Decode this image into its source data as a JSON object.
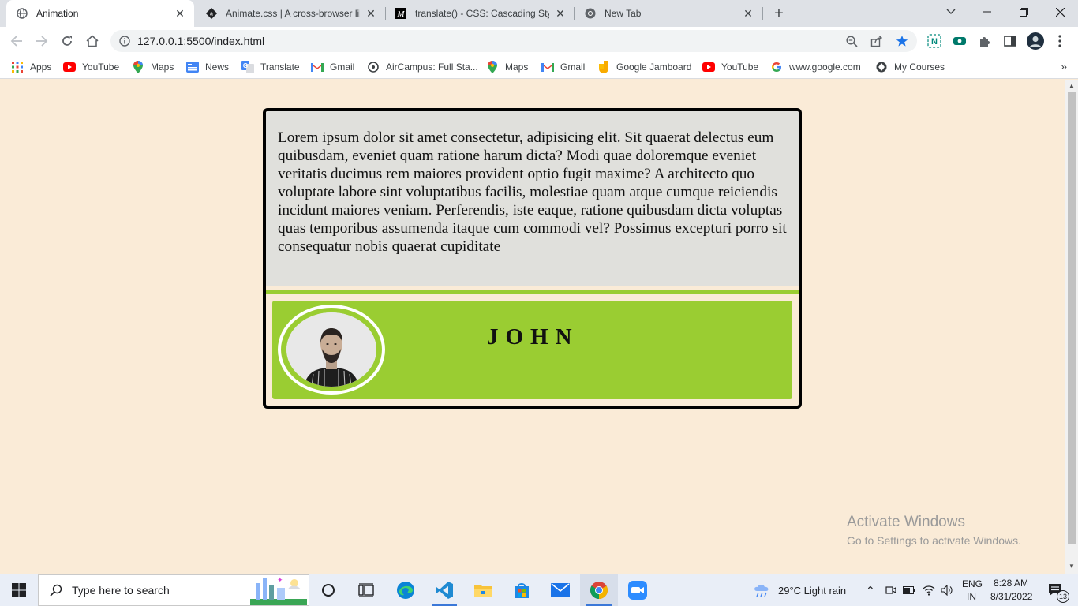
{
  "browser": {
    "tabs": [
      {
        "title": "Animation",
        "active": true,
        "icon": "globe-icon"
      },
      {
        "title": "Animate.css | A cross-browser lib",
        "active": false,
        "icon": "animate-icon"
      },
      {
        "title": "translate() - CSS: Cascading Style",
        "active": false,
        "icon": "mdn-icon"
      },
      {
        "title": "New Tab",
        "active": false,
        "icon": "chrome-icon"
      }
    ],
    "url": "127.0.0.1:5500/index.html",
    "bookmarks": [
      {
        "label": "Apps",
        "icon": "apps-grid-icon"
      },
      {
        "label": "YouTube",
        "icon": "youtube-icon"
      },
      {
        "label": "Maps",
        "icon": "maps-pin-icon"
      },
      {
        "label": "News",
        "icon": "news-icon"
      },
      {
        "label": "Translate",
        "icon": "translate-icon"
      },
      {
        "label": "Gmail",
        "icon": "gmail-icon"
      },
      {
        "label": "AirCampus: Full Sta...",
        "icon": "aircampus-icon"
      },
      {
        "label": "Maps",
        "icon": "maps-pin-icon"
      },
      {
        "label": "Gmail",
        "icon": "gmail-icon"
      },
      {
        "label": "Google Jamboard",
        "icon": "jamboard-icon"
      },
      {
        "label": "YouTube",
        "icon": "youtube-icon"
      },
      {
        "label": "www.google.com",
        "icon": "google-icon"
      },
      {
        "label": "My Courses",
        "icon": "courses-icon"
      }
    ]
  },
  "page": {
    "card_text": "Lorem ipsum dolor sit amet consectetur, adipisicing elit. Sit quaerat delectus eum quibusdam, eveniet quam ratione harum dicta? Modi quae doloremque eveniet veritatis ducimus rem maiores provident optio fugit maxime? A architecto quo voluptate labore sint voluptatibus facilis, molestiae quam atque cumque reiciendis incidunt maiores veniam. Perferendis, iste eaque, ratione quibusdam dicta voluptas quas temporibus assumenda itaque cum commodi vel? Possimus excepturi porro sit consequatur nobis quaerat cupiditate",
    "name": "JOHN"
  },
  "watermark": {
    "line1": "Activate Windows",
    "line2": "Go to Settings to activate Windows."
  },
  "taskbar": {
    "search_placeholder": "Type here to search",
    "weather": "29°C  Light rain",
    "lang_line1": "ENG",
    "lang_line2": "IN",
    "time": "8:28 AM",
    "date": "8/31/2022",
    "notification_count": "13"
  },
  "colors": {
    "page_bg": "#faebd7",
    "card_text_bg": "#e0e0dc",
    "accent_green": "#9acd32",
    "bookmark_star": "#1a73e8"
  }
}
